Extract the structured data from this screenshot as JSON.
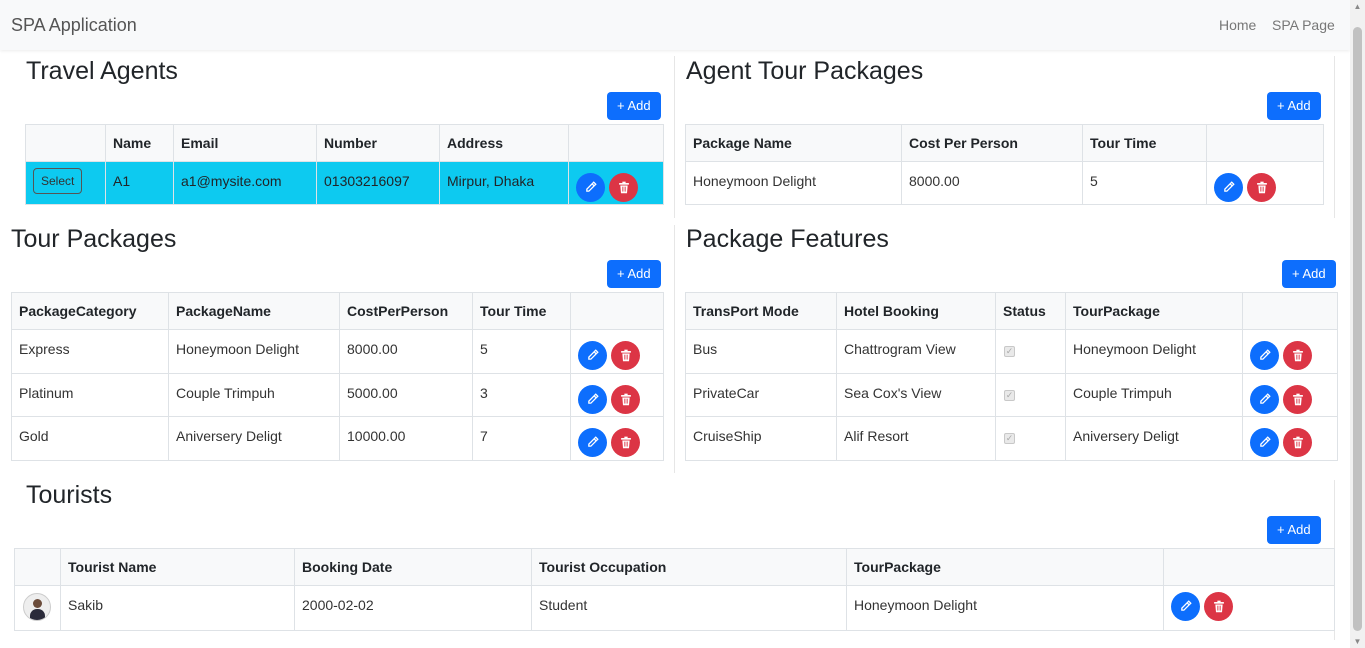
{
  "navbar": {
    "brand": "SPA Application",
    "links": [
      "Home",
      "SPA Page"
    ]
  },
  "common": {
    "add_label": "+ Add",
    "edit_icon": "pencil-icon",
    "delete_icon": "trash-icon"
  },
  "travel_agents": {
    "title": "Travel Agents",
    "columns": [
      "",
      "Name",
      "Email",
      "Number",
      "Address",
      ""
    ],
    "rows": [
      {
        "select_label": "Select",
        "name": "A1",
        "email": "a1@mysite.com",
        "number": "01303216097",
        "address": "Mirpur, Dhaka"
      }
    ]
  },
  "agent_tour_packages": {
    "title": "Agent Tour Packages",
    "columns": [
      "Package Name",
      "Cost Per Person",
      "Tour Time",
      ""
    ],
    "rows": [
      {
        "package_name": "Honeymoon Delight",
        "cost": "8000.00",
        "tour_time": "5"
      }
    ]
  },
  "tour_packages": {
    "title": "Tour Packages",
    "columns": [
      "PackageCategory",
      "PackageName",
      "CostPerPerson",
      "Tour Time",
      ""
    ],
    "rows": [
      {
        "category": "Express",
        "name": "Honeymoon Delight",
        "cost": "8000.00",
        "tour_time": "5"
      },
      {
        "category": "Platinum",
        "name": "Couple Trimpuh",
        "cost": "5000.00",
        "tour_time": "3"
      },
      {
        "category": "Gold",
        "name": "Aniversery Deligt",
        "cost": "10000.00",
        "tour_time": "7"
      }
    ]
  },
  "package_features": {
    "title": "Package Features",
    "columns": [
      "TransPort Mode",
      "Hotel Booking",
      "Status",
      "TourPackage",
      ""
    ],
    "rows": [
      {
        "transport": "Bus",
        "hotel": "Chattrogram View",
        "status": true,
        "tour_package": "Honeymoon Delight"
      },
      {
        "transport": "PrivateCar",
        "hotel": "Sea Cox's View",
        "status": true,
        "tour_package": "Couple Trimpuh"
      },
      {
        "transport": "CruiseShip",
        "hotel": "Alif Resort",
        "status": true,
        "tour_package": "Aniversery Deligt"
      }
    ]
  },
  "tourists": {
    "title": "Tourists",
    "columns": [
      "",
      "Tourist Name",
      "Booking Date",
      "Tourist Occupation",
      "TourPackage",
      ""
    ],
    "rows": [
      {
        "name": "Sakib",
        "booking_date": "2000-02-02",
        "occupation": "Student",
        "tour_package": "Honeymoon Delight"
      }
    ]
  },
  "colors": {
    "primary": "#0d6efd",
    "danger": "#dc3545",
    "selected_row": "#0dcaf0"
  }
}
